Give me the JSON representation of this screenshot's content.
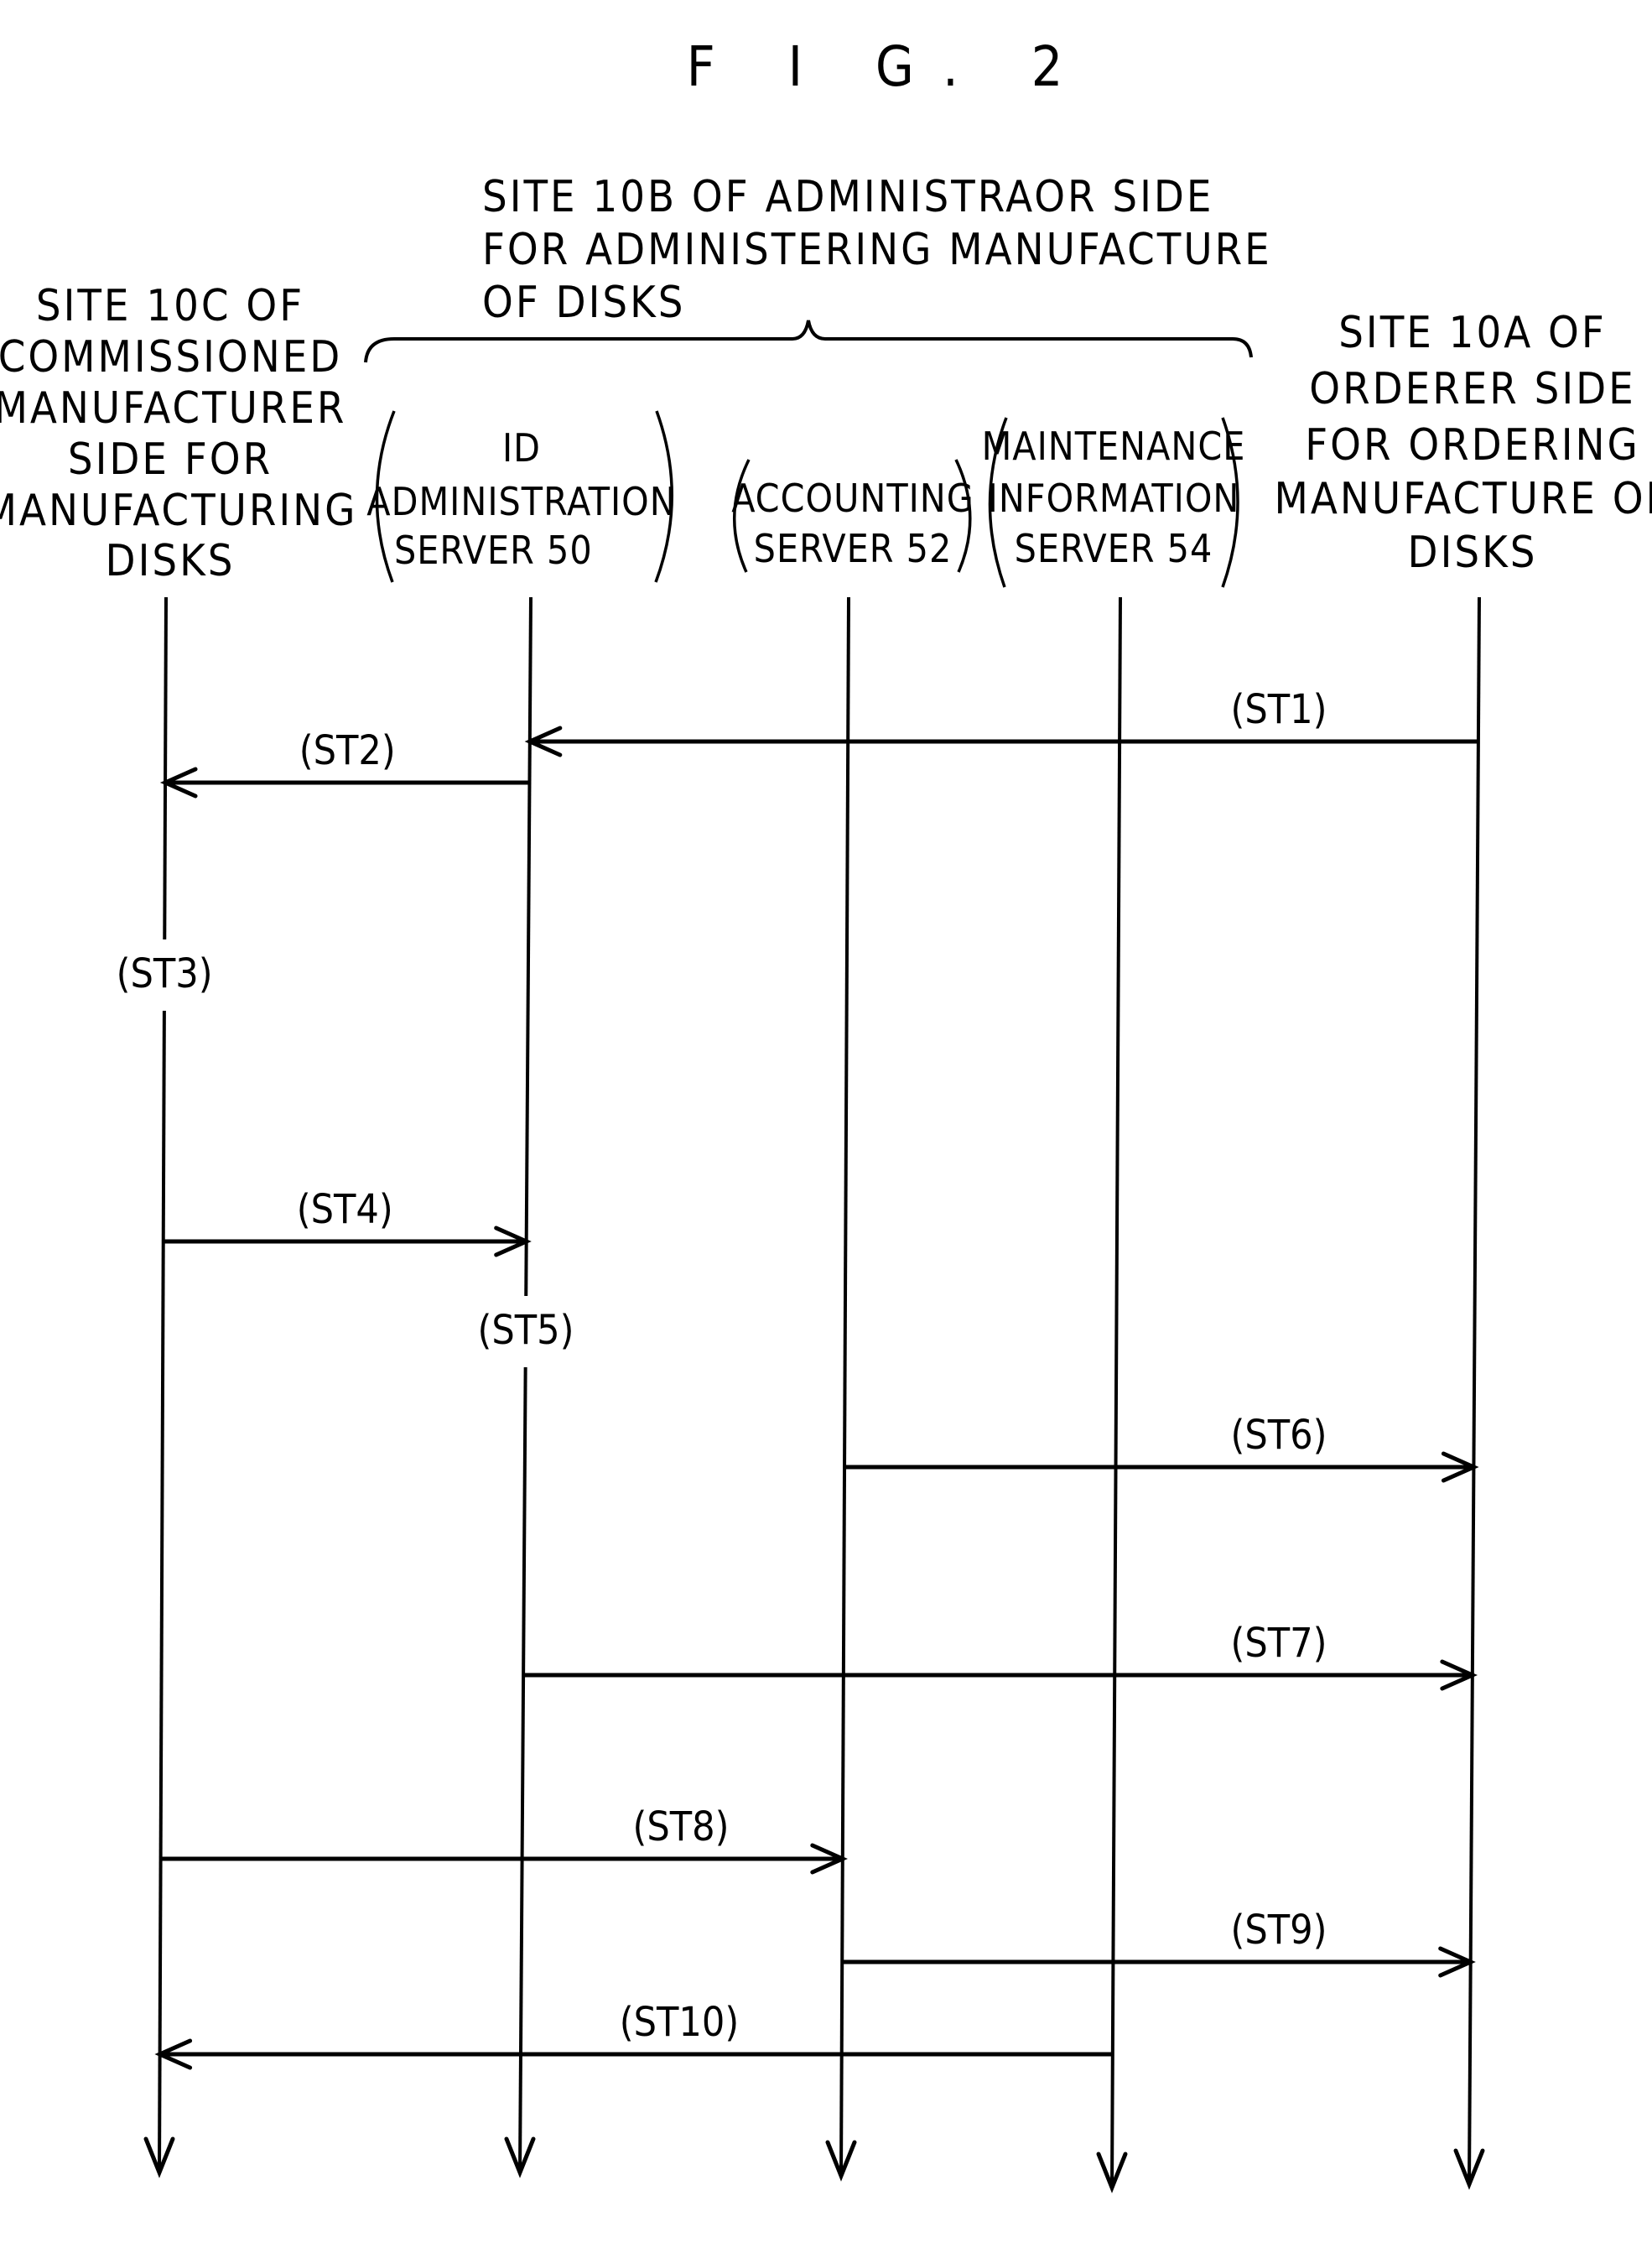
{
  "figure": {
    "title": "F I G. 2"
  },
  "group": {
    "label_lines": [
      "SITE 10B OF ADMINISTRAOR SIDE",
      "FOR ADMINISTERING MANUFACTURE",
      "OF DISKS"
    ],
    "members": [
      "id_server",
      "accounting_server",
      "maintenance_server"
    ]
  },
  "participants": [
    {
      "id": "site_10c",
      "label_lines": [
        "SITE 10C OF",
        "COMMISSIONED",
        "MANUFACTURER",
        "SIDE FOR",
        "MANUFACTURING",
        "DISKS"
      ],
      "parenthesized": false
    },
    {
      "id": "id_server",
      "label_lines": [
        "ID",
        "ADMINISTRATION",
        "SERVER 50"
      ],
      "parenthesized": true
    },
    {
      "id": "accounting_server",
      "label_lines": [
        "ACCOUNTING",
        "SERVER 52"
      ],
      "parenthesized": true
    },
    {
      "id": "maintenance_server",
      "label_lines": [
        "MAINTENANCE",
        "INFORMATION",
        "SERVER 54"
      ],
      "parenthesized": true
    },
    {
      "id": "site_10a",
      "label_lines": [
        "SITE 10A OF",
        "ORDERER SIDE",
        "FOR ORDERING",
        "MANUFACTURE OF",
        "DISKS"
      ],
      "parenthesized": false
    }
  ],
  "steps": [
    {
      "label": "(ST1)",
      "type": "message",
      "from": "site_10a",
      "to": "id_server"
    },
    {
      "label": "(ST2)",
      "type": "message",
      "from": "id_server",
      "to": "site_10c"
    },
    {
      "label": "(ST3)",
      "type": "local",
      "at": "site_10c"
    },
    {
      "label": "(ST4)",
      "type": "message",
      "from": "site_10c",
      "to": "id_server"
    },
    {
      "label": "(ST5)",
      "type": "local",
      "at": "id_server"
    },
    {
      "label": "(ST6)",
      "type": "message",
      "from": "accounting_server",
      "to": "site_10a"
    },
    {
      "label": "(ST7)",
      "type": "message",
      "from": "id_server",
      "to": "site_10a"
    },
    {
      "label": "(ST8)",
      "type": "message",
      "from": "site_10c",
      "to": "accounting_server"
    },
    {
      "label": "(ST9)",
      "type": "message",
      "from": "accounting_server",
      "to": "site_10a"
    },
    {
      "label": "(ST10)",
      "type": "message",
      "from": "maintenance_server",
      "to": "site_10c"
    }
  ]
}
